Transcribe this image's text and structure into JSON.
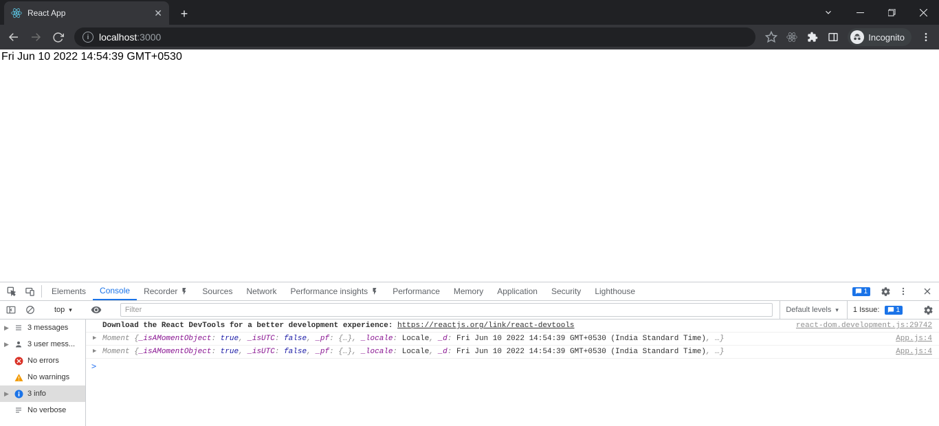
{
  "browser": {
    "tab_title": "React App",
    "url_host": "localhost",
    "url_port": ":3000",
    "incognito_label": "Incognito"
  },
  "page": {
    "body_text": "Fri Jun 10 2022 14:54:39 GMT+0530"
  },
  "devtools": {
    "tabs": [
      "Elements",
      "Console",
      "Recorder",
      "Sources",
      "Network",
      "Performance insights",
      "Performance",
      "Memory",
      "Application",
      "Security",
      "Lighthouse"
    ],
    "active_tab": "Console",
    "issue_count": "1",
    "toolbar": {
      "context": "top",
      "filter_placeholder": "Filter",
      "default_levels": "Default levels",
      "issues_label": "1 Issue:",
      "issues_count": "1"
    },
    "sidebar": [
      {
        "icon": "list",
        "label": "3 messages"
      },
      {
        "icon": "user",
        "label": "3 user mess..."
      },
      {
        "icon": "error",
        "label": "No errors"
      },
      {
        "icon": "warning",
        "label": "No warnings"
      },
      {
        "icon": "info",
        "label": "3 info"
      },
      {
        "icon": "verbose",
        "label": "No verbose"
      }
    ],
    "console": {
      "devtools_prefix": "Download the React DevTools for a better development experience: ",
      "devtools_link": "https://reactjs.org/link/react-devtools",
      "devtools_src": "react-dom.development.js:29742",
      "moment_line_1": "Moment {_isAMomentObject: true, _isUTC: false, _pf: {…}, _locale: Locale, _d: Fri Jun 10 2022 14:54:39 GMT+0530 (India Standard Time), …}",
      "moment_line_2": "Moment {_isAMomentObject: true, _isUTC: false, _pf: {…}, _locale: Locale, _d: Fri Jun 10 2022 14:54:39 GMT+0530 (India Standard Time), …}",
      "moment_src_1": "App.js:4",
      "moment_src_2": "App.js:4",
      "prompt": ">"
    }
  }
}
